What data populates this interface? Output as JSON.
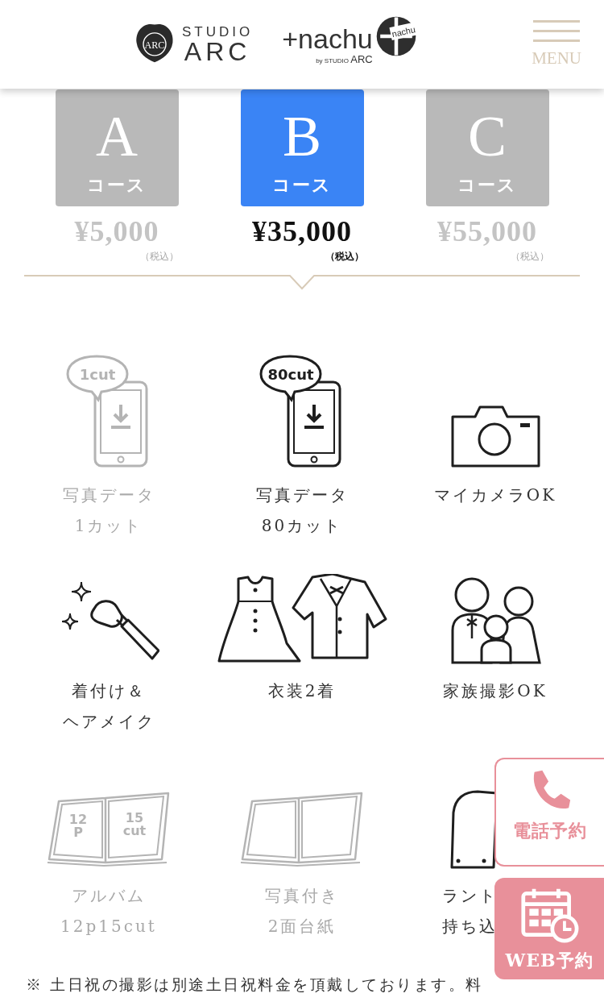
{
  "header": {
    "studio_logo": {
      "emblem": "ARC",
      "top": "STUDIO",
      "bottom": "ARC"
    },
    "nachu_logo": {
      "name": "+nachu",
      "byline_prefix": "by STUDIO",
      "byline_brand": "ARC",
      "seal": "nachu"
    },
    "menu": {
      "label": "MENU"
    }
  },
  "courses": [
    {
      "letter": "A",
      "label": "コース",
      "price": "¥5,000",
      "tax": "（税込）",
      "selected": false
    },
    {
      "letter": "B",
      "label": "コース",
      "price": "¥35,000",
      "tax": "（税込）",
      "selected": true
    },
    {
      "letter": "C",
      "label": "コース",
      "price": "¥55,000",
      "tax": "（税込）",
      "selected": false
    }
  ],
  "features": [
    {
      "kind": "phone",
      "badges": [
        [
          "1cut"
        ]
      ],
      "lines": [
        "写真データ",
        "1カット"
      ],
      "available": false
    },
    {
      "kind": "phone",
      "badges": [
        [
          "80cut"
        ]
      ],
      "lines": [
        "写真データ",
        "80カット"
      ],
      "available": true
    },
    {
      "kind": "camera",
      "lines": [
        "マイカメラOK"
      ],
      "available": true
    },
    {
      "kind": "brush",
      "lines": [
        "着付け＆",
        "ヘアメイク"
      ],
      "available": true
    },
    {
      "kind": "clothes",
      "lines": [
        "衣装2着"
      ],
      "available": true
    },
    {
      "kind": "family",
      "lines": [
        "家族撮影OK"
      ],
      "available": true
    },
    {
      "kind": "album",
      "badges": [
        [
          "12",
          "P"
        ],
        [
          "15",
          "cut"
        ]
      ],
      "lines": [
        "アルバム",
        "12p15cut"
      ],
      "available": false
    },
    {
      "kind": "mount",
      "lines": [
        "写真付き",
        "2面台紙"
      ],
      "available": false
    },
    {
      "kind": "backpack",
      "lines": [
        "ラント",
        "持ち込"
      ],
      "available": true
    }
  ],
  "note": "※ 土日祝の撮影は別途土日祝料金を頂戴しております。料",
  "floating_buttons": [
    {
      "kind": "phone",
      "label": "電話予約"
    },
    {
      "kind": "web",
      "label": "WEB予約"
    }
  ]
}
